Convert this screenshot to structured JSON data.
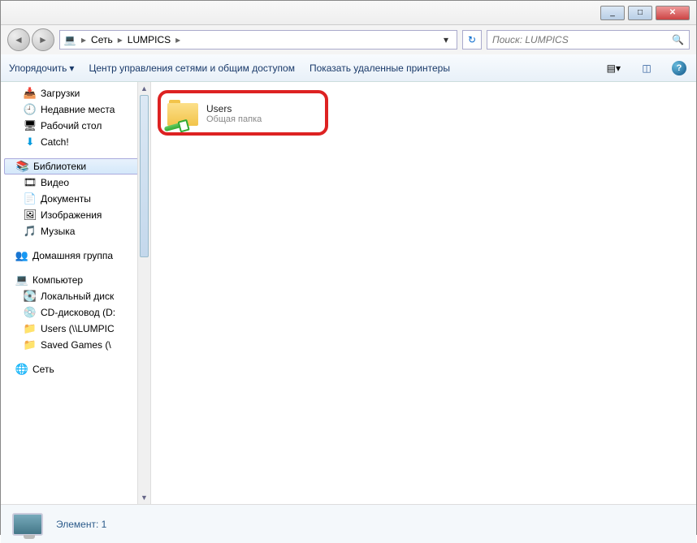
{
  "window": {
    "controls": {
      "min": "_",
      "max": "□",
      "close": "✕"
    }
  },
  "nav": {
    "back": "◄",
    "forward": "►",
    "breadcrumb": {
      "seg1": "Сеть",
      "seg2": "LUMPICS",
      "arrow": "▸"
    },
    "dropdown": "▾",
    "refresh": "↻"
  },
  "search": {
    "placeholder": "Поиск: LUMPICS",
    "icon": "🔍"
  },
  "toolbar": {
    "organize": "Упорядочить",
    "network_center": "Центр управления сетями и общим доступом",
    "remote_printers": "Показать удаленные принтеры",
    "dropdown_arrow": "▾",
    "help": "?"
  },
  "sidebar": {
    "items": [
      {
        "icon": "📥",
        "label": "Загрузки"
      },
      {
        "icon": "🕘",
        "label": "Недавние места"
      },
      {
        "icon": "🖥",
        "label": "Рабочий стол"
      },
      {
        "icon": "⬇",
        "label": "Catch!"
      }
    ],
    "libraries": {
      "icon": "📚",
      "label": "Библиотеки"
    },
    "lib_items": [
      {
        "icon": "🎞",
        "label": "Видео"
      },
      {
        "icon": "📄",
        "label": "Документы"
      },
      {
        "icon": "🖼",
        "label": "Изображения"
      },
      {
        "icon": "🎵",
        "label": "Музыка"
      }
    ],
    "homegroup": {
      "icon": "👥",
      "label": "Домашняя группа"
    },
    "computer": {
      "icon": "💻",
      "label": "Компьютер"
    },
    "comp_items": [
      {
        "icon": "💽",
        "label": "Локальный диск"
      },
      {
        "icon": "💿",
        "label": "CD-дисковод (D:"
      },
      {
        "icon": "📁",
        "label": "Users (\\\\LUMPIC"
      },
      {
        "icon": "📁",
        "label": "Saved Games (\\"
      }
    ],
    "network": {
      "icon": "🌐",
      "label": "Сеть"
    }
  },
  "content": {
    "folder": {
      "name": "Users",
      "subtitle": "Общая папка"
    }
  },
  "status": {
    "text": "Элемент: 1"
  }
}
